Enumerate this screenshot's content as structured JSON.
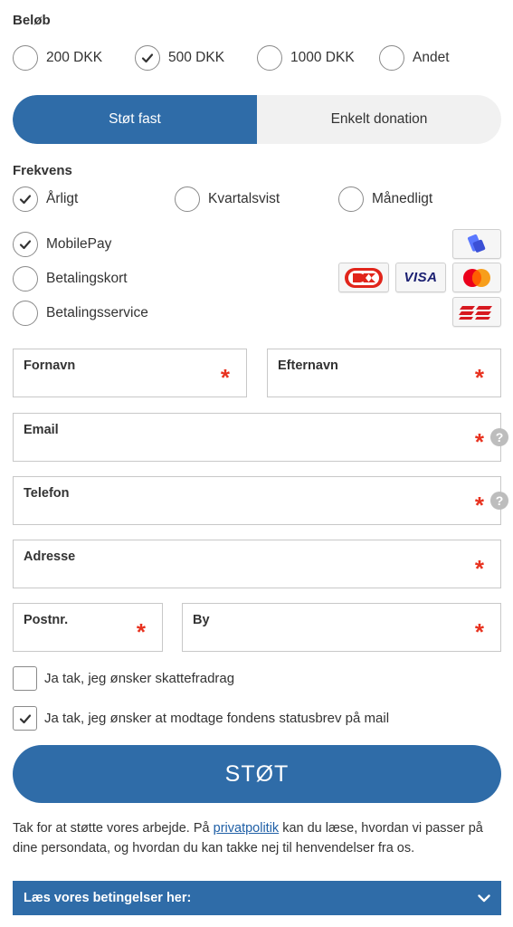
{
  "amount": {
    "title": "Beløb",
    "options": [
      {
        "label": "200 DKK",
        "selected": false
      },
      {
        "label": "500 DKK",
        "selected": true
      },
      {
        "label": "1000 DKK",
        "selected": false
      },
      {
        "label": "Andet",
        "selected": false
      }
    ]
  },
  "donation_type": {
    "recurring_label": "Støt fast",
    "single_label": "Enkelt donation",
    "active": "recurring"
  },
  "frequency": {
    "title": "Frekvens",
    "options": [
      {
        "label": "Årligt",
        "selected": true
      },
      {
        "label": "Kvartalsvist",
        "selected": false
      },
      {
        "label": "Månedligt",
        "selected": false
      }
    ]
  },
  "payment": {
    "options": [
      {
        "label": "MobilePay",
        "selected": true
      },
      {
        "label": "Betalingskort",
        "selected": false
      },
      {
        "label": "Betalingsservice",
        "selected": false
      }
    ],
    "card_logos": [
      "dankort-logo",
      "visa-logo",
      "mastercard-logo"
    ],
    "visa_text": "VISA"
  },
  "form": {
    "first_name_label": "Fornavn",
    "last_name_label": "Efternavn",
    "email_label": "Email",
    "phone_label": "Telefon",
    "address_label": "Adresse",
    "postcode_label": "Postnr.",
    "city_label": "By",
    "required_mark": "*",
    "help_mark": "?"
  },
  "consents": [
    {
      "label": "Ja tak, jeg ønsker skattefradrag",
      "checked": false
    },
    {
      "label": "Ja tak, jeg ønsker at modtage fondens statusbrev på mail",
      "checked": true
    }
  ],
  "submit_label": "STØT",
  "privacy": {
    "before": "Tak for at støtte vores arbejde. På ",
    "link": "privatpolitik",
    "after": " kan du læse, hvordan vi passer på dine persondata, og hvordan du kan takke nej til henvendelser fra os."
  },
  "terms_label": "Læs vores betingelser her:",
  "colors": {
    "primary": "#2f6ca8",
    "required": "#e8321f",
    "toggle_inactive_bg": "#f1f1f1"
  }
}
